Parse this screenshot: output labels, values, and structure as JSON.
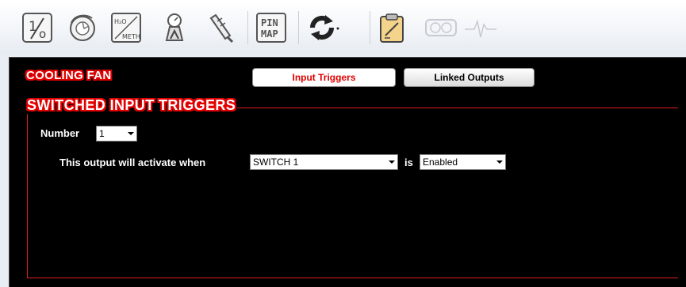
{
  "toolbar": {
    "buttons": [
      {
        "name": "ratio-icon"
      },
      {
        "name": "turbo-icon"
      },
      {
        "name": "h2o-meth-icon",
        "line1": "H2O",
        "line2": "METH"
      },
      {
        "name": "boost-gauge-icon"
      },
      {
        "name": "injector-icon"
      },
      {
        "name": "pin-map-icon",
        "line1": "PIN",
        "line2": "MAP"
      },
      {
        "name": "refresh-icon"
      },
      {
        "name": "clipboard-icon"
      },
      {
        "name": "gauge-icon"
      },
      {
        "name": "pulse-icon"
      }
    ]
  },
  "panel": {
    "title": "COOLING FAN",
    "tabs": {
      "input_triggers": "Input Triggers",
      "linked_outputs": "Linked Outputs"
    },
    "group_title": "SWITCHED INPUT TRIGGERS",
    "number_label": "Number",
    "number_value": "1",
    "activate_label": "This output will activate when",
    "switch_value": "SWITCH 1",
    "is_label": "is",
    "state_value": "Enabled"
  },
  "colors": {
    "accent_red": "#e30000",
    "panel_bg": "#000000"
  }
}
